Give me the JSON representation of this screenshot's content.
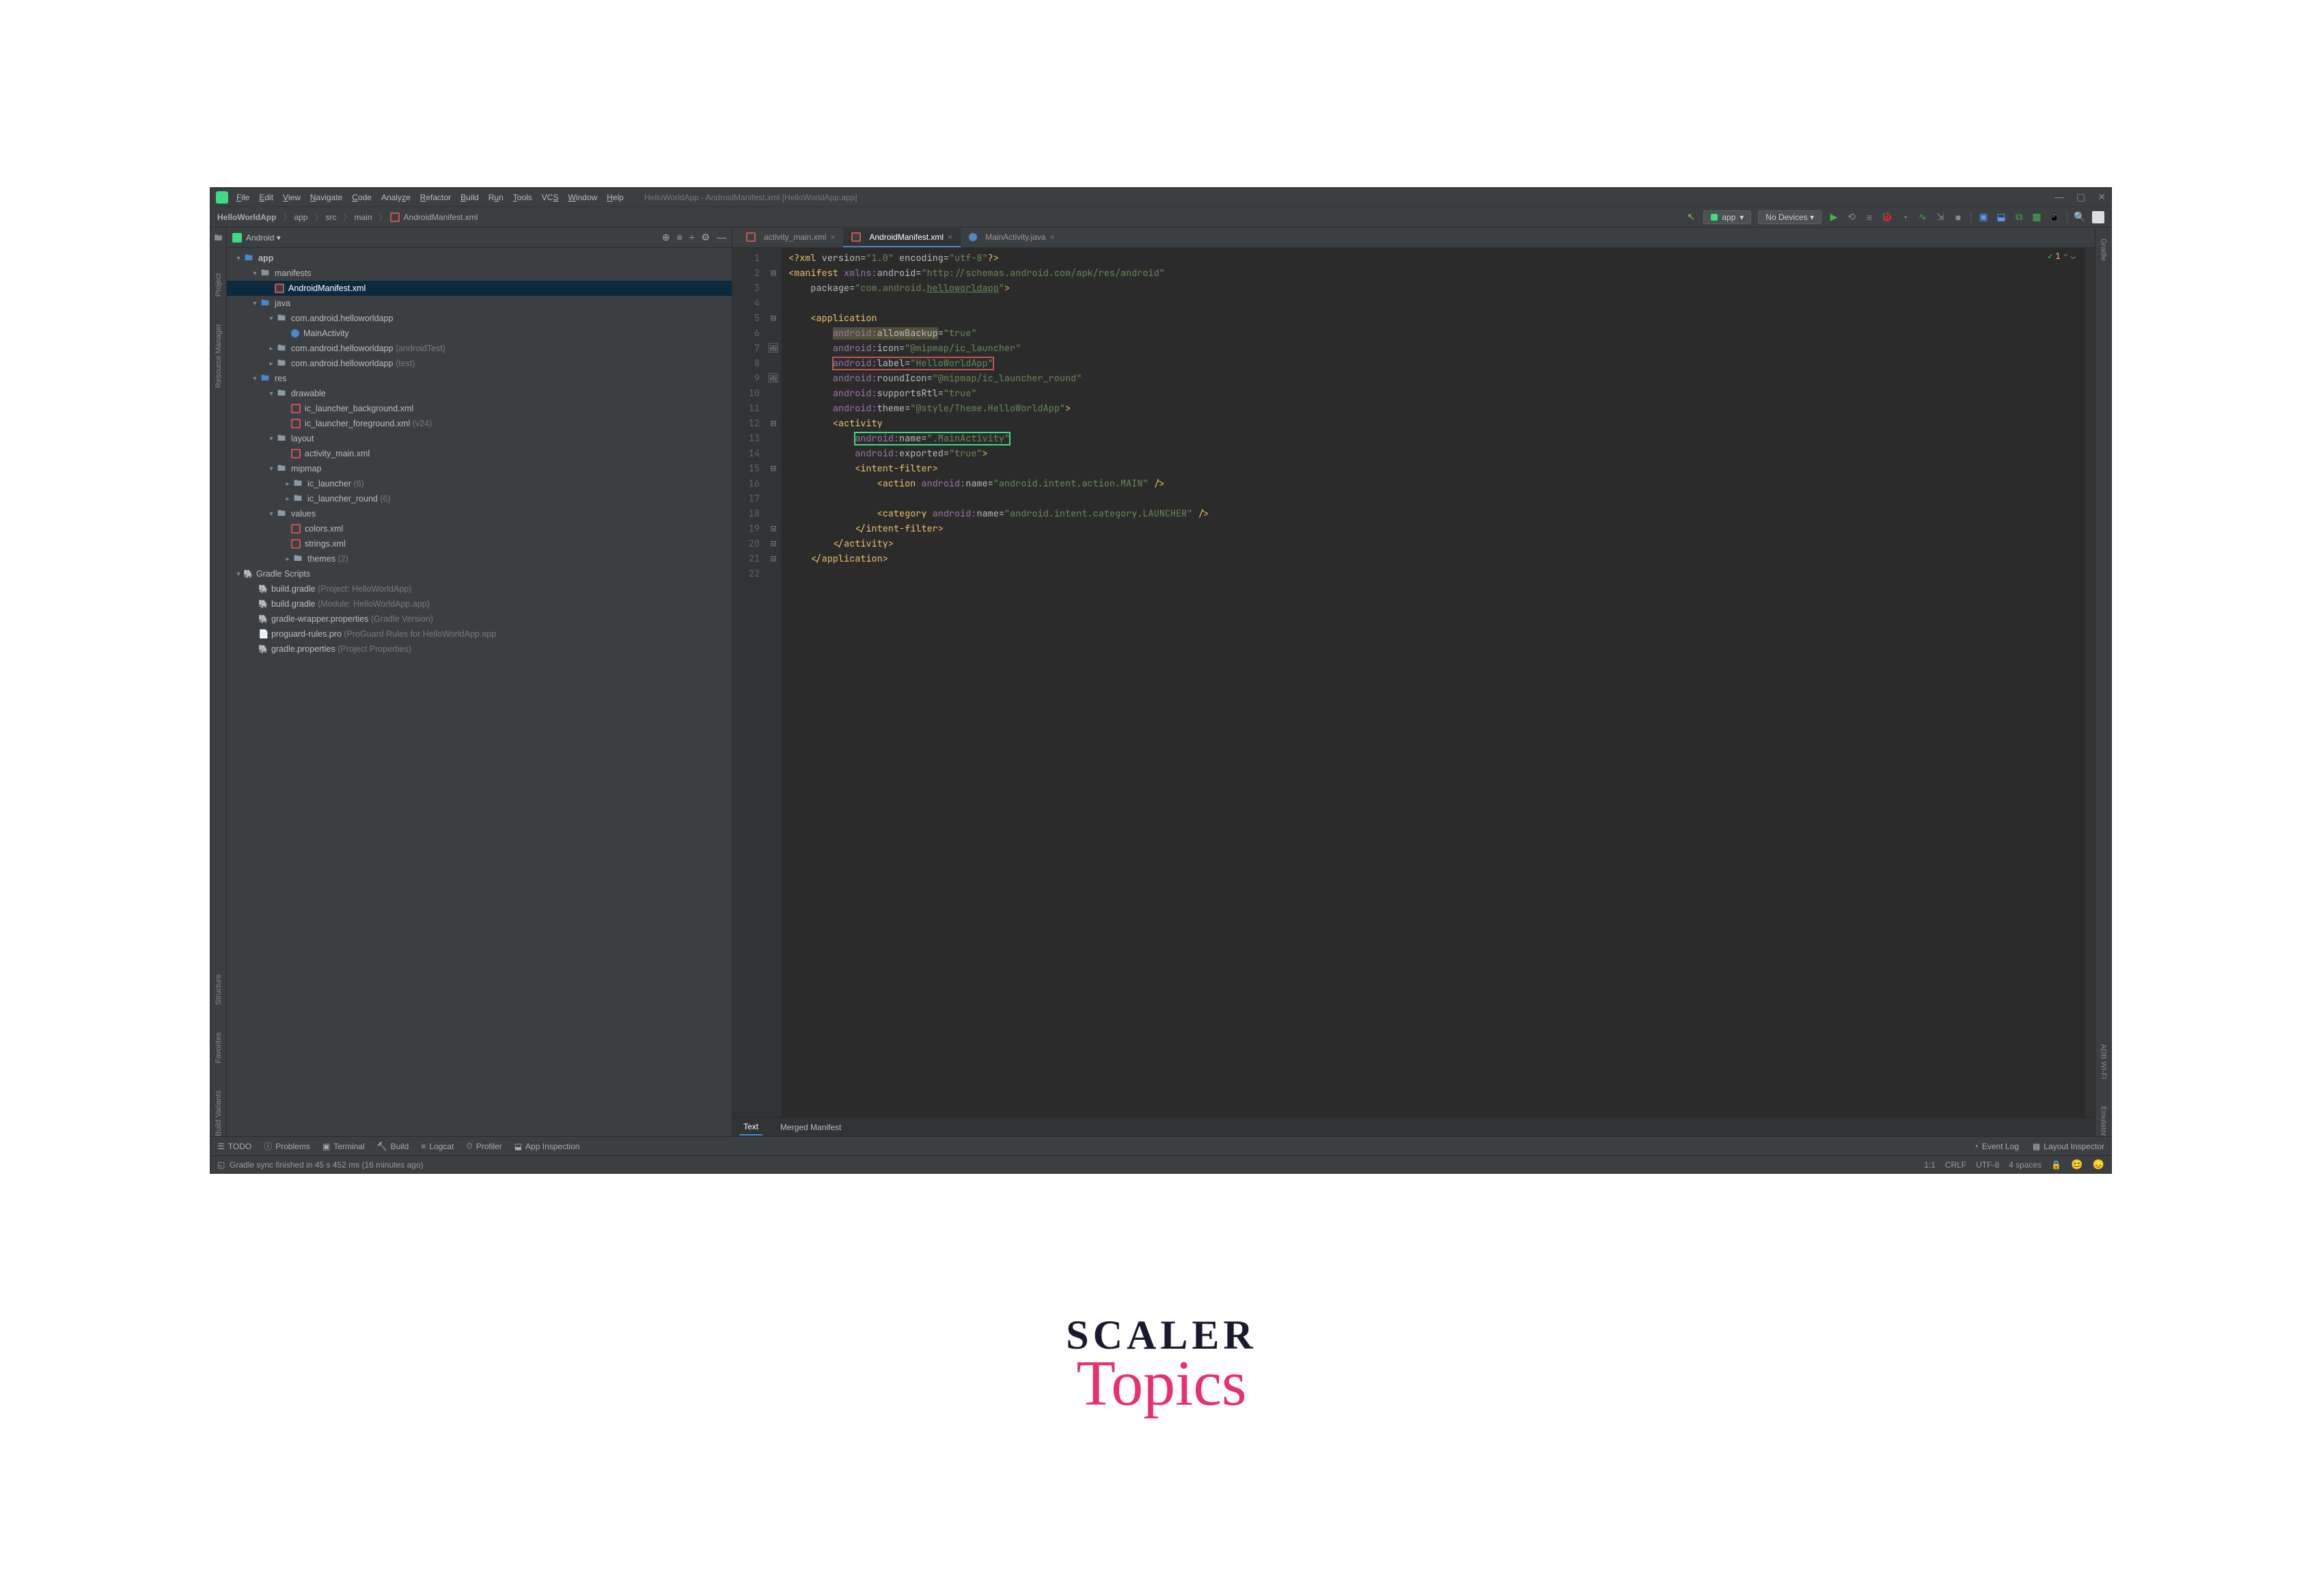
{
  "menu": [
    "File",
    "Edit",
    "View",
    "Navigate",
    "Code",
    "Analyze",
    "Refactor",
    "Build",
    "Run",
    "Tools",
    "VCS",
    "Window",
    "Help"
  ],
  "window_title": "HelloWorldApp - AndroidManifest.xml [HelloWorldApp.app]",
  "breadcrumb": [
    "HelloWorldApp",
    "app",
    "src",
    "main",
    "AndroidManifest.xml"
  ],
  "run_config": "app",
  "device_selector": "No Devices  ▾",
  "left_rail": [
    "Project",
    "Resource Manager",
    "Structure",
    "Favorites",
    "Build Variants"
  ],
  "right_rail": [
    "Gradle",
    "ADB Wi-Fi",
    "Emulator"
  ],
  "sidebar_header": "Android  ▾",
  "tree": {
    "app": "app",
    "manifests": "manifests",
    "manifest_file": "AndroidManifest.xml",
    "java": "java",
    "pkg1": "com.android.helloworldapp",
    "main_activity": "MainActivity",
    "pkg2": "com.android.helloworldapp",
    "pkg2_suffix": "(androidTest)",
    "pkg3": "com.android.helloworldapp",
    "pkg3_suffix": "(test)",
    "res": "res",
    "drawable": "drawable",
    "drawable_f1": "ic_launcher_background.xml",
    "drawable_f2": "ic_launcher_foreground.xml",
    "drawable_f2_suffix": "(v24)",
    "layout": "layout",
    "layout_f1": "activity_main.xml",
    "mipmap": "mipmap",
    "mipmap_c1": "ic_launcher",
    "mipmap_c1_suffix": "(6)",
    "mipmap_c2": "ic_launcher_round",
    "mipmap_c2_suffix": "(6)",
    "values": "values",
    "values_f1": "colors.xml",
    "values_f2": "strings.xml",
    "values_c3": "themes",
    "values_c3_suffix": "(2)",
    "gradle_scripts": "Gradle Scripts",
    "gradle_g1": "build.gradle",
    "gradle_g1_suffix": "(Project: HelloWorldApp)",
    "gradle_g2": "build.gradle",
    "gradle_g2_suffix": "(Module: HelloWorldApp.app)",
    "gradle_g3": "gradle-wrapper.properties",
    "gradle_g3_suffix": "(Gradle Version)",
    "gradle_g4": "proguard-rules.pro",
    "gradle_g4_suffix": "(ProGuard Rules for HelloWorldApp.app",
    "gradle_g5": "gradle.properties",
    "gradle_g5_suffix": "(Project Properties)"
  },
  "editor_tabs": [
    {
      "label": "activity_main.xml",
      "active": false
    },
    {
      "label": "AndroidManifest.xml",
      "active": true
    },
    {
      "label": "MainActivity.java",
      "active": false
    }
  ],
  "inspection": {
    "warnings": "1"
  },
  "code": {
    "l1_pi": "<?xml version=\"1.0\" encoding=\"utf-8\"?>",
    "l2": "<manifest xmlns:android=\"http://schemas.android.com/apk/res/android\"",
    "l3": "    package=\"com.android.helloworldapp\">",
    "l5": "    <application",
    "l6": "        android:allowBackup=\"true\"",
    "l7": "        android:icon=\"@mipmap/ic_launcher\"",
    "l8": "        android:label=\"HelloWorldApp\"",
    "l9": "        android:roundIcon=\"@mipmap/ic_launcher_round\"",
    "l10": "        android:supportsRtl=\"true\"",
    "l11": "        android:theme=\"@style/Theme.HelloWorldApp\">",
    "l12": "        <activity",
    "l13": "            android:name=\".MainActivity\"",
    "l14": "            android:exported=\"true\">",
    "l15": "            <intent-filter>",
    "l16": "                <action android:name=\"android.intent.action.MAIN\" />",
    "l18": "                <category android:name=\"android.intent.category.LAUNCHER\" />",
    "l19": "            </intent-filter>",
    "l20": "        </activity>",
    "l21": "    </application>"
  },
  "bottom_tabs": [
    "Text",
    "Merged Manifest"
  ],
  "toolwindows_left": [
    "TODO",
    "Problems",
    "Terminal",
    "Build",
    "Logcat",
    "Profiler",
    "App Inspection"
  ],
  "toolwindows_right": [
    "Event Log",
    "Layout Inspector"
  ],
  "status_msg": "Gradle sync finished in 45 s 452 ms (16 minutes ago)",
  "status_right": {
    "pos": "1:1",
    "sep": "CRLF",
    "enc": "UTF-8",
    "indent": "4 spaces"
  },
  "logo": {
    "top": "SCALER",
    "bottom": "Topics"
  }
}
